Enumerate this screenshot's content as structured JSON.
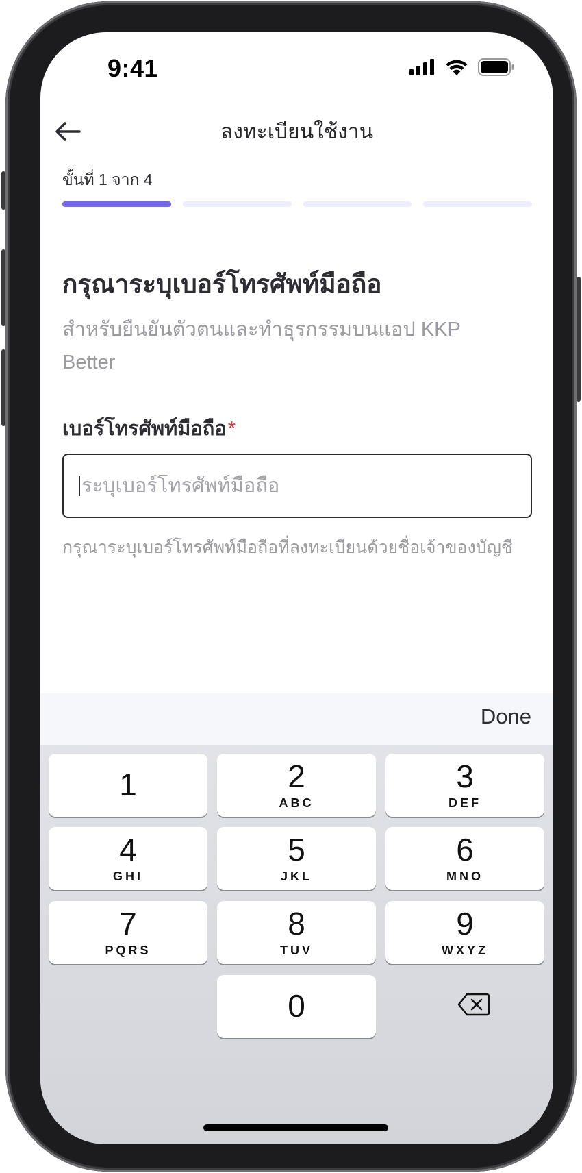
{
  "status_bar": {
    "time": "9:41",
    "icons": [
      "signal-icon",
      "wifi-icon",
      "battery-icon"
    ]
  },
  "header": {
    "back_icon": "arrow-left-icon",
    "title": "ลงทะเบียนใช้งาน"
  },
  "progress": {
    "label": "ขั้นที่ 1 จาก 4",
    "current_step": 1,
    "total_steps": 4,
    "active_color": "#7466EC",
    "inactive_color": "#EEEDFB"
  },
  "main": {
    "heading": "กรุณาระบุเบอร์โทรศัพท์มือถือ",
    "description": "สำหรับยืนยันตัวตนและทำธุรกรรมบนแอป KKP Better",
    "field": {
      "label": "เบอร์โทรศัพท์มือถือ",
      "required_mark": "*",
      "placeholder": "ระบุเบอร์โทรศัพท์มือถือ",
      "value": "",
      "helper": "กรุณาระบุเบอร์โทรศัพท์มือถือที่ลงทะเบียนด้วยชื่อเจ้าของบัญชี"
    }
  },
  "keyboard": {
    "done_label": "Done",
    "keys": [
      {
        "digit": "1",
        "letters": ""
      },
      {
        "digit": "2",
        "letters": "ABC"
      },
      {
        "digit": "3",
        "letters": "DEF"
      },
      {
        "digit": "4",
        "letters": "GHI"
      },
      {
        "digit": "5",
        "letters": "JKL"
      },
      {
        "digit": "6",
        "letters": "MNO"
      },
      {
        "digit": "7",
        "letters": "PQRS"
      },
      {
        "digit": "8",
        "letters": "TUV"
      },
      {
        "digit": "9",
        "letters": "WXYZ"
      },
      {
        "digit": "0",
        "letters": ""
      }
    ],
    "delete_icon": "backspace-icon"
  }
}
